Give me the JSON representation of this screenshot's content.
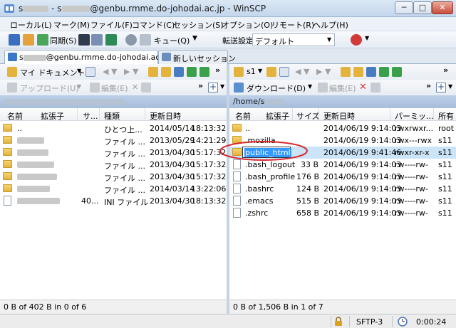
{
  "window": {
    "title_prefix": "s",
    "title_mid": "- s",
    "title_suffix": "@genbu.rmme.do-johodai.ac.jp - WinSCP",
    "btn_min": "─",
    "btn_max": "□",
    "btn_close": "✕"
  },
  "menu": [
    "ローカル(L)",
    "マーク(M)",
    "ファイル(F)",
    "コマンド(C)",
    "セッション(S)",
    "オプション(O)",
    "リモート(R)",
    "ヘルプ(H)"
  ],
  "toolbar": {
    "sync_label": "同期(S)",
    "queue_label": "キュー(Q)",
    "transfer_label": "転送設定",
    "transfer_value": "デフォルト"
  },
  "tabs": {
    "session_prefix": "s",
    "session_suffix": "@genbu.rmme.do-johodai.ac.jp",
    "new_session": "新しいセッション"
  },
  "local": {
    "location": "マイ ドキュメント",
    "upload": "アップロード(U)",
    "edit": "編集(E)",
    "columns": [
      "名前",
      "拡張子",
      "サ...",
      "種類",
      "更新日時"
    ],
    "rows": [
      {
        "name": "..",
        "size": "",
        "type": "ひとつ上...",
        "date": "2014/05/14",
        "time": "18:13:32",
        "icon": "folder-up"
      },
      {
        "name": "",
        "size": "",
        "type": "ファイル ...",
        "date": "2013/05/29",
        "time": "14:21:29",
        "icon": "folder"
      },
      {
        "name": "",
        "size": "",
        "type": "ファイル ...",
        "date": "2013/04/30",
        "time": "15:17:32",
        "icon": "folder"
      },
      {
        "name": "",
        "size": "",
        "type": "ファイル ...",
        "date": "2013/04/30",
        "time": "15:17:32",
        "icon": "folder"
      },
      {
        "name": "",
        "size": "",
        "type": "ファイル ...",
        "date": "2013/04/30",
        "time": "15:17:32",
        "icon": "folder"
      },
      {
        "name": "",
        "size": "",
        "type": "ファイル ...",
        "date": "2014/03/14",
        "time": "13:22:06",
        "icon": "folder"
      },
      {
        "name": "",
        "size": "40...",
        "type": "INI ファイル",
        "date": "2013/04/30",
        "time": "18:13:32",
        "icon": "ini-file"
      }
    ],
    "status": "0 B of 402 B in 0 of 6"
  },
  "remote": {
    "location": "s1",
    "path": "/home/s",
    "download": "ダウンロード(D)",
    "edit": "編集(E)",
    "columns": [
      "名前",
      "拡張子",
      "サイズ",
      "更新日時",
      "パーミッ...",
      "所有"
    ],
    "rows": [
      {
        "name": "..",
        "size": "",
        "date": "2014/06/19 9:14:03",
        "perm": "rwxrwxr...",
        "owner": "root",
        "icon": "folder-up"
      },
      {
        "name": ".mozilla",
        "size": "",
        "date": "2014/06/19 9:14:03",
        "perm": "rwx---rwx",
        "owner": "s11",
        "icon": "folder"
      },
      {
        "name": "public_html",
        "size": "",
        "date": "2014/06/19 9:41:46",
        "perm": "rwxr-xr-x",
        "owner": "s11",
        "icon": "folder"
      },
      {
        "name": ".bash_logout",
        "size": "33 B",
        "date": "2014/06/19 9:14:03",
        "perm": "rw----rw-",
        "owner": "s11",
        "icon": "file"
      },
      {
        "name": ".bash_profile",
        "size": "176 B",
        "date": "2014/06/19 9:14:03",
        "perm": "rw----rw-",
        "owner": "s11",
        "icon": "file"
      },
      {
        "name": ".bashrc",
        "size": "124 B",
        "date": "2014/06/19 9:14:03",
        "perm": "rw----rw-",
        "owner": "s11",
        "icon": "file"
      },
      {
        "name": ".emacs",
        "size": "515 B",
        "date": "2014/06/19 9:14:03",
        "perm": "rw----rw-",
        "owner": "s11",
        "icon": "file"
      },
      {
        "name": ".zshrc",
        "size": "658 B",
        "date": "2014/06/19 9:14:03",
        "perm": "rw----rw-",
        "owner": "s11",
        "icon": "file"
      }
    ],
    "rename_value": "public_html",
    "status": "0 B of 1,506 B in 1 of 7"
  },
  "status": {
    "protocol": "SFTP-3",
    "elapsed": "0:00:24"
  },
  "colors": {
    "selection": "#cce4f7",
    "annotation": "#d9262c",
    "path_bar": "#a6bedc"
  }
}
